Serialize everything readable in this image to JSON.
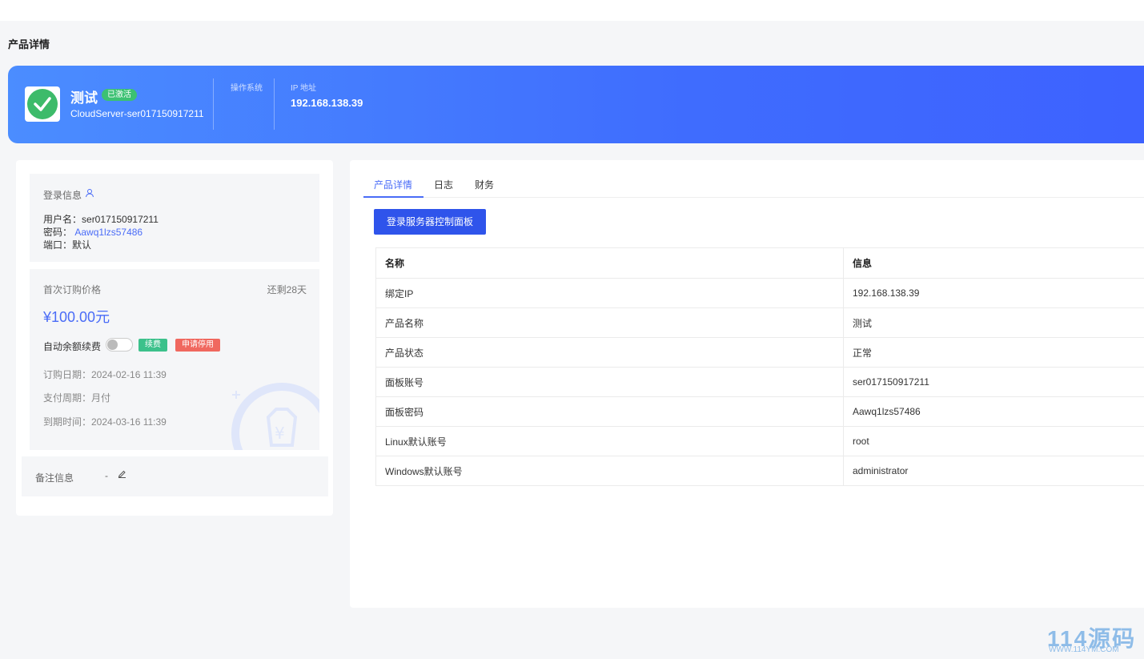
{
  "page": {
    "title": "产品详情"
  },
  "banner": {
    "product_name": "测试",
    "status_badge": "已激活",
    "server_id": "CloudServer-ser017150917211",
    "os_label": "操作系统",
    "os_value": "",
    "ip_label": "IP 地址",
    "ip_value": "192.168.138.39",
    "status_icon": "check-icon"
  },
  "login_info": {
    "title": "登录信息",
    "icon": "user-icon",
    "username_label": "用户名：",
    "username_value": "ser017150917211",
    "password_label": "密码：",
    "password_value": "Aawq1lzs57486",
    "port_label": "端口：",
    "port_value": "默认"
  },
  "billing": {
    "first_price_label": "首次订购价格",
    "remaining": "还剩28天",
    "price": "¥100.00元",
    "auto_renew_label": "自动余额续费",
    "auto_renew_enabled": false,
    "renew_button": "续费",
    "suspend_button": "申请停用",
    "order_date": "订购日期：2024-02-16 11:39",
    "pay_cycle": "支付周期：月付",
    "expire_time": "到期时间：2024-03-16 11:39"
  },
  "notes": {
    "label": "备注信息",
    "value": "-",
    "icon": "edit-icon"
  },
  "tabs": [
    {
      "label": "产品详情",
      "active": true
    },
    {
      "label": "日志",
      "active": false
    },
    {
      "label": "财务",
      "active": false
    }
  ],
  "console_button": "登录服务器控制面板",
  "table": {
    "headers": [
      "名称",
      "信息"
    ],
    "rows": [
      [
        "绑定IP",
        "192.168.138.39"
      ],
      [
        "产品名称",
        "测试"
      ],
      [
        "产品状态",
        "正常"
      ],
      [
        "面板账号",
        "ser017150917211"
      ],
      [
        "面板密码",
        "Aawq1lzs57486"
      ],
      [
        "Linux默认账号",
        "root"
      ],
      [
        "Windows默认账号",
        "administrator"
      ]
    ]
  },
  "watermark": {
    "main": "114源码",
    "sub": "WWW.114YM.COM"
  },
  "colors": {
    "accent": "#4a6cf7",
    "primary_button": "#2f54eb",
    "success": "#3cc18b",
    "danger": "#f0685f",
    "banner_start": "#4b8dff",
    "banner_end": "#3d62ff"
  }
}
